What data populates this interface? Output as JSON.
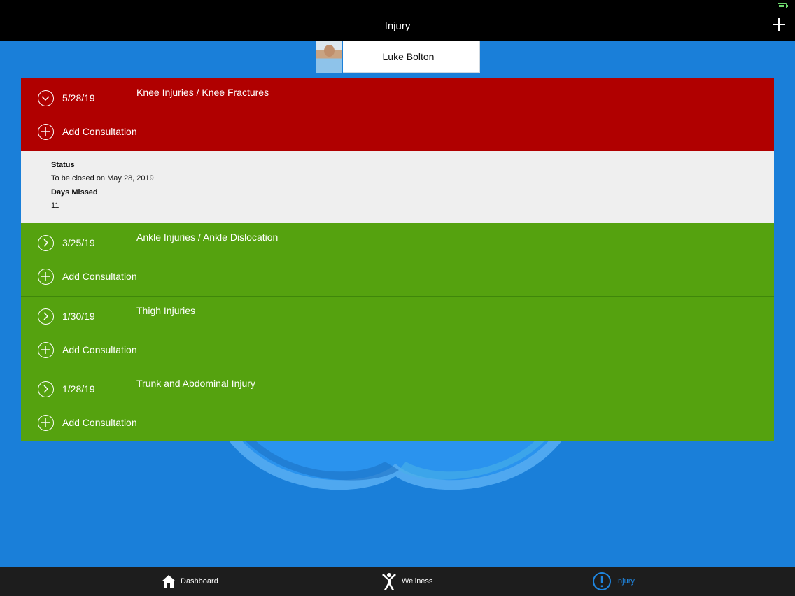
{
  "header": {
    "title": "Injury"
  },
  "player": {
    "name": "Luke Bolton"
  },
  "injuries": [
    {
      "date": "5/28/19",
      "type": "Knee Injuries / Knee Fractures",
      "consult_label": "Add Consultation",
      "status_color": "#b00000",
      "expanded": true,
      "details": {
        "status_label": "Status",
        "status_value": "To be closed on May 28, 2019",
        "days_missed_label": "Days Missed",
        "days_missed_value": "11"
      }
    },
    {
      "date": "3/25/19",
      "type": "Ankle Injuries / Ankle Dislocation",
      "consult_label": "Add Consultation",
      "status_color": "#55a20f",
      "expanded": false
    },
    {
      "date": "1/30/19",
      "type": "Thigh Injuries",
      "consult_label": "Add Consultation",
      "status_color": "#55a20f",
      "expanded": false
    },
    {
      "date": "1/28/19",
      "type": "Trunk and Abdominal Injury",
      "consult_label": "Add Consultation",
      "status_color": "#55a20f",
      "expanded": false
    }
  ],
  "tabs": {
    "dashboard": "Dashboard",
    "wellness": "Wellness",
    "injury": "Injury",
    "active": "injury"
  },
  "colors": {
    "background": "#1a7fd9",
    "active_tab": "#1f86e0"
  }
}
